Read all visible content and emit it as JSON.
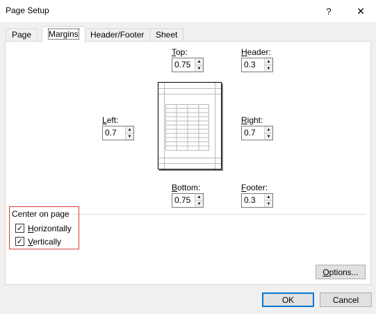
{
  "window": {
    "title": "Page Setup",
    "help_label": "?",
    "close_label": "✕"
  },
  "tabs": [
    {
      "label": "Page",
      "active": false
    },
    {
      "label": "Margins",
      "active": true
    },
    {
      "label": "Header/Footer",
      "active": false
    },
    {
      "label": "Sheet",
      "active": false
    }
  ],
  "margins": {
    "top": {
      "label_key": "T",
      "label_rest": "op:",
      "value": "0.75"
    },
    "header": {
      "label_key": "H",
      "label_rest": "eader:",
      "value": "0.3"
    },
    "left": {
      "label_key": "L",
      "label_rest": "eft:",
      "value": "0.7"
    },
    "right": {
      "label_key": "R",
      "label_rest": "ight:",
      "value": "0.7"
    },
    "bottom": {
      "label_key": "B",
      "label_rest": "ottom:",
      "value": "0.75"
    },
    "footer": {
      "label_key": "F",
      "label_rest": "ooter:",
      "value": "0.3"
    }
  },
  "center_on_page": {
    "label": "Center on page",
    "horizontally": {
      "label_key": "H",
      "label_rest": "orizontally",
      "checked": true
    },
    "vertically": {
      "label_key": "V",
      "label_rest": "ertically",
      "checked": true
    }
  },
  "buttons": {
    "options_key": "O",
    "options_rest": "ptions...",
    "ok": "OK",
    "cancel": "Cancel"
  },
  "icons": {
    "check": "✓",
    "spin_up": "▲",
    "spin_down": "▼"
  },
  "colors": {
    "highlight": "#d93a3a",
    "default_button_border": "#0078d7"
  }
}
